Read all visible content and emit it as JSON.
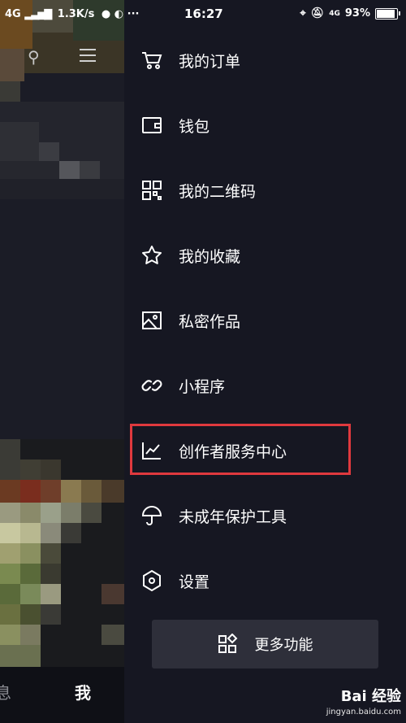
{
  "status_bar": {
    "left": "4G",
    "speed": "1.3K/s",
    "time": "16:27",
    "battery": "93%",
    "net_badge": "4G"
  },
  "left_nav": {
    "messages_partial": "息",
    "me": "我"
  },
  "drawer": {
    "items": [
      {
        "label": "我的订单",
        "icon": "cart-icon"
      },
      {
        "label": "钱包",
        "icon": "wallet-icon"
      },
      {
        "label": "我的二维码",
        "icon": "qr-code-icon"
      },
      {
        "label": "我的收藏",
        "icon": "star-icon"
      },
      {
        "label": "私密作品",
        "icon": "image-icon"
      },
      {
        "label": "小程序",
        "icon": "link-icon"
      },
      {
        "label": "创作者服务中心",
        "icon": "chart-icon",
        "highlighted": true
      },
      {
        "label": "未成年保护工具",
        "icon": "umbrella-icon"
      },
      {
        "label": "设置",
        "icon": "settings-hex-icon"
      }
    ],
    "more_button": {
      "label": "更多功能",
      "icon": "grid-apps-icon"
    }
  },
  "watermark": {
    "brand": "Bai 经验",
    "url": "jingyan.baidu.com"
  },
  "colors": {
    "background": "#161722",
    "highlight": "#e0393e",
    "button_bg": "#2e2f3a"
  }
}
